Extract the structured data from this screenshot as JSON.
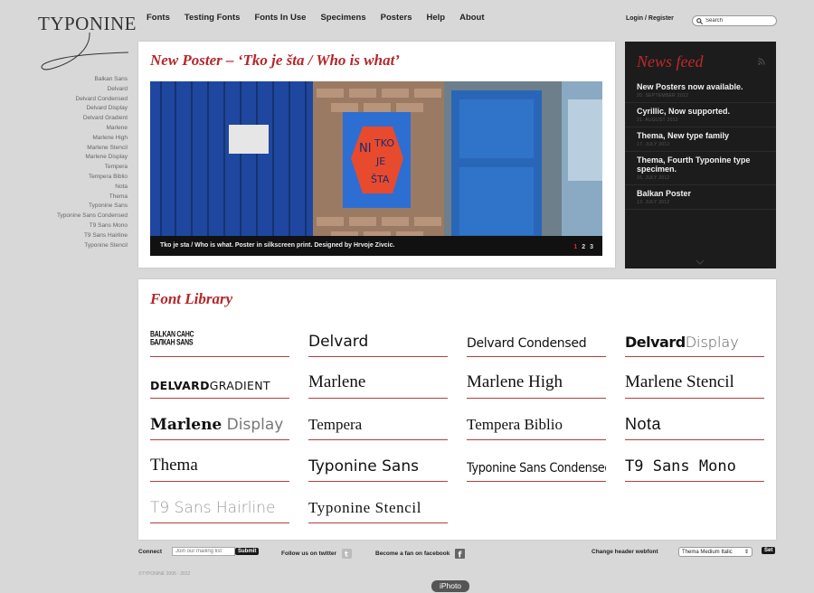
{
  "logo": {
    "text": "TYPONINE"
  },
  "nav": {
    "items": [
      "Fonts",
      "Testing Fonts",
      "Fonts In Use",
      "Specimens",
      "Posters",
      "Help",
      "About"
    ],
    "login": "Login / Register",
    "search_placeholder": "Search"
  },
  "sidebar": {
    "fonts": [
      "Balkan Sans",
      "Delvard",
      "Delvard Condensed",
      "Delvard Display",
      "Delvard Gradient",
      "Marlene",
      "Marlene High",
      "Marlene Stencil",
      "Marlene Display",
      "Tempera",
      "Tempera Biblio",
      "Nota",
      "Thema",
      "Typonine Sans",
      "Typonine Sans Condensed",
      "T9 Sans Mono",
      "T9 Sans Hairline",
      "Typonine Stencil"
    ]
  },
  "poster": {
    "title": "New Poster – ‘Tko je šta / Who is what’",
    "caption": "Tko je sta / Who is what. Poster in silkscreen print. Designed by Hrvoje Zivcic.",
    "pages": [
      "1",
      "2",
      "3"
    ],
    "active_page": "1",
    "poster_text": [
      "NI",
      "TKO",
      "JE",
      "ŠTA"
    ]
  },
  "news": {
    "title": "News feed",
    "items": [
      {
        "title": "New Posters now available.",
        "date": "20. SEPTEMBER 2012"
      },
      {
        "title": "Cyrillic, Now supported.",
        "date": "21. AUGUST 2012"
      },
      {
        "title": "Thema, New type family",
        "date": "17. JULY 2012"
      },
      {
        "title": "Thema, Fourth Typonine type specimen.",
        "date": "16. JULY 2012"
      },
      {
        "title": "Balkan Poster",
        "date": "13. JULY 2012"
      }
    ]
  },
  "library": {
    "title": "Font Library",
    "balkan": [
      "BALKAN САНС",
      "БАЛКАН SANS"
    ],
    "delvard": "Delvard",
    "delvard_condensed": "Delvard Condensed",
    "delvard_display_bold": "Delvard",
    "delvard_display_light": "Display",
    "delvard_gradient_a": "DELVARD",
    "delvard_gradient_b": "GRADIENT",
    "marlene": "Marlene",
    "marlene_high": "Marlene High",
    "marlene_stencil": "Marlene Stencil",
    "marlene_display_bold": "Marlene",
    "marlene_display_light": "Display",
    "tempera": "Tempera",
    "tempera_biblio": "Tempera Biblio",
    "nota": "Nota",
    "thema": "Thema",
    "typonine_sans": "Typonine Sans",
    "typonine_sans_condensed": "Typonine Sans Condensed",
    "t9_sans_mono": "T9 Sans Mono",
    "t9_sans_hairline": "T9 Sans Hairline",
    "typonine_stencil": "Typonine Stencil"
  },
  "footer": {
    "connect": "Connect",
    "mail_placeholder": "Join our mailing list",
    "submit": "Submit",
    "twitter": "Follow us on twitter",
    "facebook": "Become a fan on facebook",
    "webfont_label": "Change header webfont",
    "webfont_value": "Thema Medium Italic",
    "set": "Set",
    "copyright": "©TYPONINE 2006 - 2012"
  },
  "dock": {
    "label": "iPhoto"
  },
  "colors": {
    "accent": "#b4272a",
    "news_bg": "#1c1c1c",
    "page_bg": "#d8d8d8"
  }
}
